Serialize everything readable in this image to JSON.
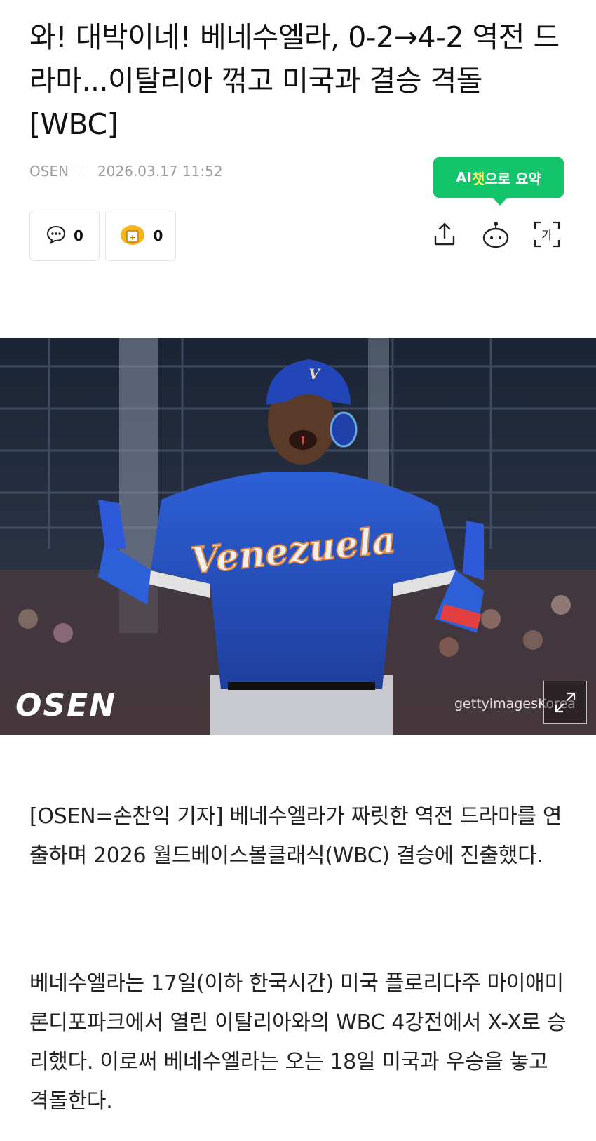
{
  "article": {
    "headline": "와! 대박이네! 베네수엘라, 0-2→4-2 역전 드라마...이탈리아 꺾고 미국과 결승 격돌 [WBC]",
    "source": "OSEN",
    "datetime": "2026.03.17 11:52"
  },
  "ai_summary": {
    "prefix": "AI",
    "highlight": "챗",
    "suffix": "으로 요약"
  },
  "reactions": {
    "comment_count": "0",
    "emoji_count": "0"
  },
  "toolbar": {
    "icons": [
      "share-icon",
      "ai-bot-icon",
      "font-size-icon"
    ],
    "font_label": "가"
  },
  "photo": {
    "watermark": "OSEN",
    "credit": "gettyimagesKorea",
    "jersey_text": "Venezuela"
  },
  "body": {
    "paragraphs": [
      "[OSEN=손찬익 기자] 베네수엘라가 짜릿한 역전 드라마를 연출하며 2026 월드베이스볼클래식(WBC) 결승에 진출했다.",
      "베네수엘라는 17일(이하 한국시간) 미국 플로리다주 마이애미 론디포파크에서 열린 이탈리아와의 WBC 4강전에서 X-X로 승리했다. 이로써 베네수엘라는 오는 18일 미국과 우승을 놓고 격돌한다."
    ]
  },
  "colors": {
    "ai_green": "#12c56a",
    "ai_highlight": "#fff35c",
    "meta_gray": "#9a9a9a",
    "jersey_blue": "#2550c8"
  }
}
